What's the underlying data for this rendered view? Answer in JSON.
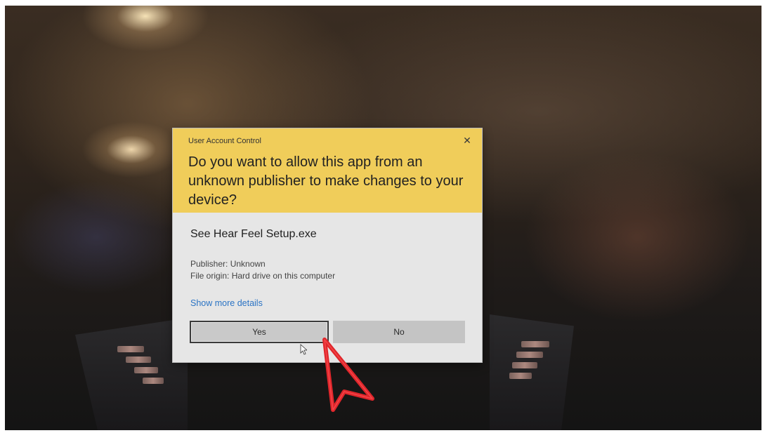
{
  "dialog": {
    "caption": "User Account Control",
    "close_glyph": "✕",
    "question": "Do you want to allow this app from an unknown publisher to make changes to your device?",
    "app_name": "See Hear Feel Setup.exe",
    "publisher": "Publisher: Unknown",
    "file_origin": "File origin: Hard drive on this computer",
    "details_link": "Show more details",
    "yes_label": "Yes",
    "no_label": "No"
  },
  "colors": {
    "header": "#f0cd5a",
    "body": "#e6e6e6",
    "link": "#2a73c4",
    "button": "#c9c9c9",
    "annotation_arrow": "#e0262b"
  },
  "icons": {
    "close": "close-icon",
    "pointer": "mouse-pointer-icon",
    "annotation": "red-arrow-icon"
  }
}
